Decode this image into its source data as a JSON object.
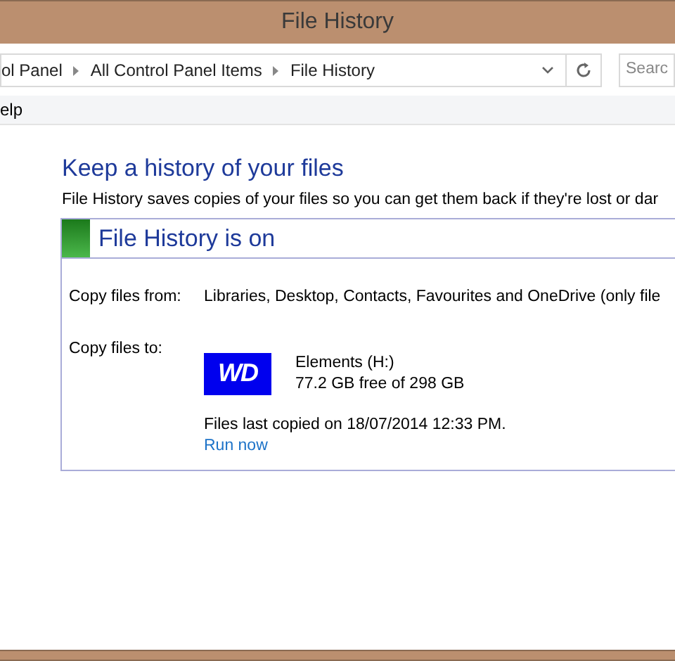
{
  "window": {
    "title": "File History"
  },
  "address_bar": {
    "breadcrumbs": [
      "ol Panel",
      "All Control Panel Items",
      "File History"
    ]
  },
  "search": {
    "placeholder": "Searc"
  },
  "menu_bar": {
    "items": [
      "elp"
    ]
  },
  "heading": "Keep a history of your files",
  "description": "File History saves copies of your files so you can get them back if they're lost or dar",
  "status_panel": {
    "title": "File History is on",
    "on": true,
    "rows": [
      {
        "label": "Copy files from:",
        "value": "Libraries, Desktop, Contacts, Favourites and OneDrive (only file"
      },
      {
        "label": "Copy files to:",
        "drive": {
          "logo_text": "WD",
          "name": "Elements (H:)",
          "space": "77.2 GB free of 298 GB"
        },
        "last_copied": "Files last copied on 18/07/2014 12:33 PM.",
        "link": "Run now"
      }
    ]
  }
}
